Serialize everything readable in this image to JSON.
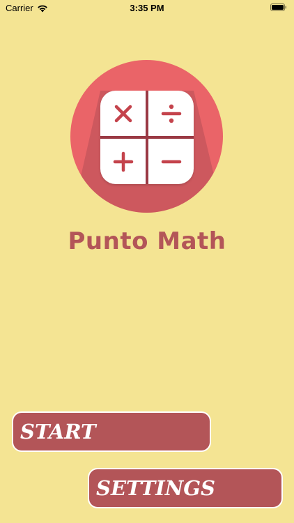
{
  "status_bar": {
    "carrier": "Carrier",
    "time": "3:35 PM",
    "icons": [
      "wifi-icon",
      "battery-icon"
    ]
  },
  "logo": {
    "symbols": [
      "×",
      "÷",
      "+",
      "−"
    ],
    "circle_color": "#ea6468",
    "card_color": "#ffffff"
  },
  "app": {
    "title": "Punto Math"
  },
  "buttons": {
    "start_label": "START",
    "settings_label": "SETTINGS"
  },
  "colors": {
    "background": "#f4e493",
    "accent": "#b35558"
  }
}
